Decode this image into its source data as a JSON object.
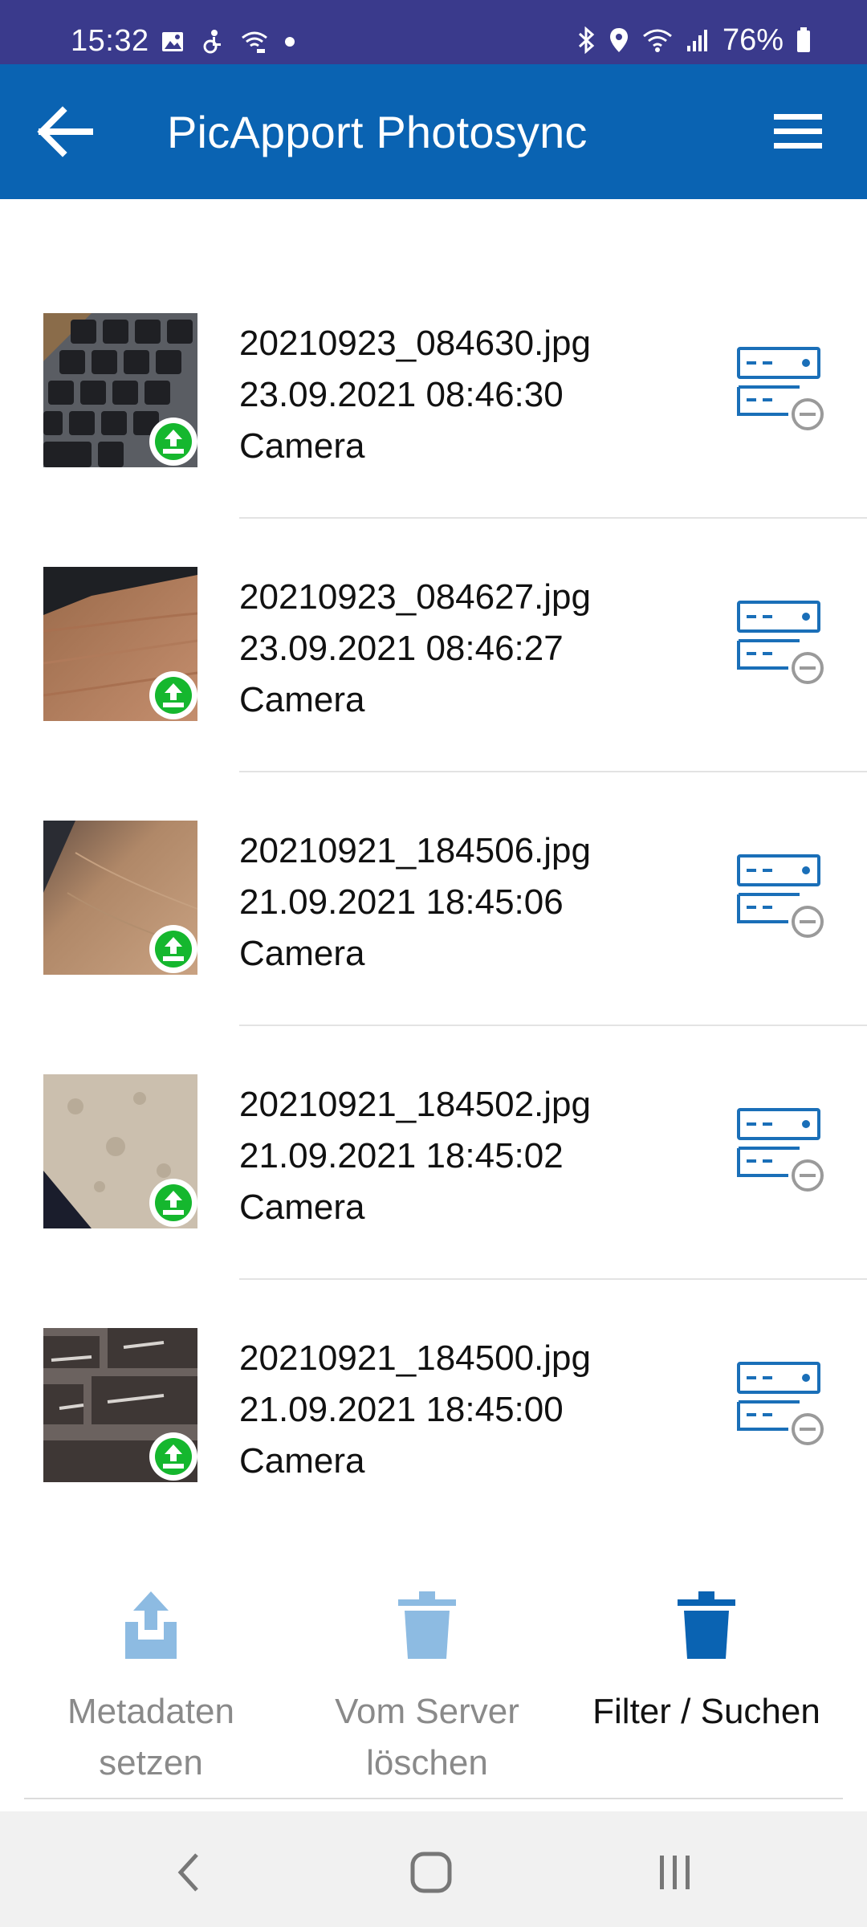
{
  "status_bar": {
    "time": "15:32",
    "battery": "76%",
    "left_icons": [
      "image-icon",
      "accessibility-icon",
      "wifi-call-icon",
      "dot-icon"
    ],
    "right_icons": [
      "bluetooth-icon",
      "location-icon",
      "wifi-icon",
      "signal-icon",
      "battery-icon"
    ]
  },
  "app_bar": {
    "title": "PicApport Photosync",
    "back_icon": "arrow-back-icon",
    "menu_icon": "hamburger-menu-icon",
    "color": "#0a63b2"
  },
  "photos": [
    {
      "filename": "20210923_084630.jpg",
      "datetime": "23.09.2021 08:46:30",
      "source": "Camera"
    },
    {
      "filename": "20210923_084627.jpg",
      "datetime": "23.09.2021 08:46:27",
      "source": "Camera"
    },
    {
      "filename": "20210921_184506.jpg",
      "datetime": "21.09.2021 18:45:06",
      "source": "Camera"
    },
    {
      "filename": "20210921_184502.jpg",
      "datetime": "21.09.2021 18:45:02",
      "source": "Camera"
    },
    {
      "filename": "20210921_184500.jpg",
      "datetime": "21.09.2021 18:45:00",
      "source": "Camera"
    }
  ],
  "toolbar": {
    "metadata_label_1": "Metadaten",
    "metadata_label_2": "setzen",
    "delete_label_1": "Vom Server",
    "delete_label_2": "löschen",
    "filter_label": "Filter / Suchen"
  },
  "colors": {
    "accent": "#0a63b2",
    "status_bar": "#3a3a8c",
    "upload_badge": "#15b72e",
    "server_icon": "#1a6fb8",
    "disabled_icon": "#8dbbe2"
  }
}
